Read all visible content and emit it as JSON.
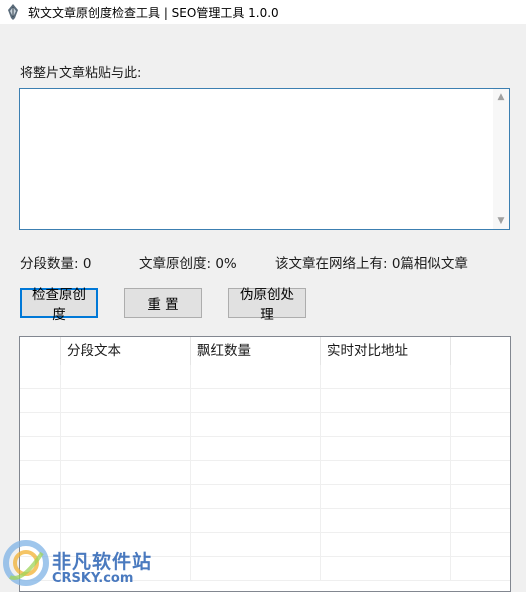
{
  "window": {
    "title": "软文文章原创度检查工具 | SEO管理工具  1.0.0"
  },
  "editor": {
    "label": "将整片文章粘贴与此:",
    "value": ""
  },
  "stats": {
    "segment_count": "分段数量:  0",
    "originality": "文章原创度:  0%",
    "similar": "该文章在网络上有:  0篇相似文章"
  },
  "buttons": {
    "check": "检查原创度",
    "reset": "重 置",
    "pseudo": "伪原创处理"
  },
  "table": {
    "columns": [
      "",
      "分段文本",
      "飘红数量",
      "实时对比地址",
      ""
    ],
    "rows": [
      [
        "",
        "",
        "",
        "",
        ""
      ],
      [
        "",
        "",
        "",
        "",
        ""
      ],
      [
        "",
        "",
        "",
        "",
        ""
      ],
      [
        "",
        "",
        "",
        "",
        ""
      ],
      [
        "",
        "",
        "",
        "",
        ""
      ],
      [
        "",
        "",
        "",
        "",
        ""
      ],
      [
        "",
        "",
        "",
        "",
        ""
      ],
      [
        "",
        "",
        "",
        "",
        ""
      ],
      [
        "",
        "",
        "",
        "",
        ""
      ]
    ]
  },
  "watermark": {
    "cn": "非凡软件站",
    "en": "CRSKY.com"
  },
  "icons": {
    "app": "app-pen-icon",
    "scroll_up": "scroll-up-icon",
    "scroll_down": "scroll-down-icon",
    "watermark_logo": "crsky-logo-icon"
  },
  "colors": {
    "focus_border": "#3c7fb1",
    "default_button_border": "#0078d7",
    "watermark": "#2b63b5"
  }
}
